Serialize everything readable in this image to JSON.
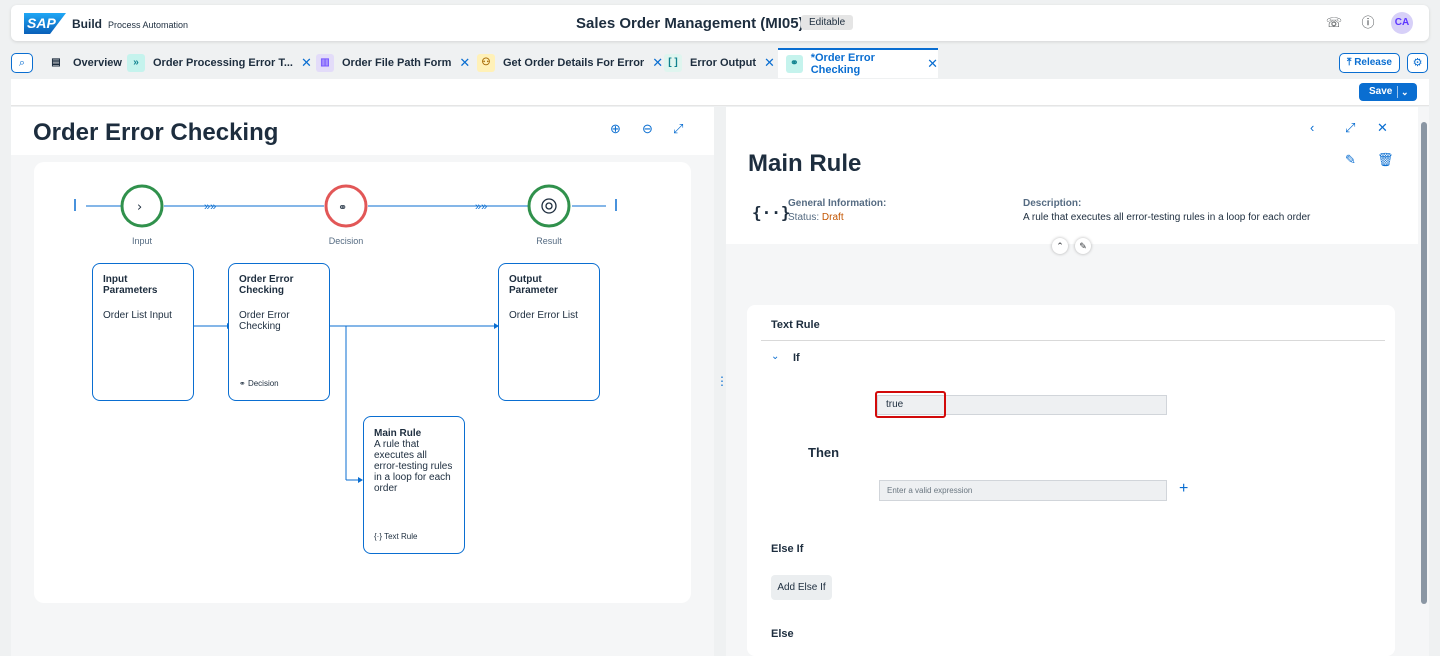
{
  "shell": {
    "logo": "SAP",
    "brand": "Build",
    "product": "Process Automation",
    "title": "Sales Order Management (MI05)",
    "badge": "Editable",
    "avatar": "CA"
  },
  "tabs": [
    {
      "label": "Overview",
      "icon": "overview-icon",
      "active": false
    },
    {
      "label": "Order Processing Error T...",
      "icon": "process-icon",
      "active": false
    },
    {
      "label": "Order File Path Form",
      "icon": "form-icon",
      "active": false
    },
    {
      "label": "Get Order Details For Error",
      "icon": "automation-icon",
      "active": false
    },
    {
      "label": "Error Output",
      "icon": "datatype-icon",
      "active": false
    },
    {
      "label": "*Order Error Checking",
      "icon": "decision-icon",
      "active": true
    }
  ],
  "toolbar": {
    "release_label": "Release",
    "save_label": "Save"
  },
  "left": {
    "title": "Order Error Checking",
    "steps": {
      "input": "Input",
      "decision": "Decision",
      "result": "Result"
    },
    "nodes": {
      "input_params": {
        "title": "Input Parameters",
        "body": "Order List Input"
      },
      "order_check": {
        "title": "Order Error Checking",
        "body": "Order Error Checking",
        "footer": "Decision"
      },
      "output_param": {
        "title": "Output Parameter",
        "body": "Order Error List"
      },
      "main_rule": {
        "title": "Main Rule",
        "body": "A rule that executes all error-testing rules in a loop for each order",
        "footer": "Text Rule"
      }
    }
  },
  "right": {
    "title": "Main Rule",
    "general_label": "General Information:",
    "status_label": "Status:",
    "status_value": "Draft",
    "description_label": "Description:",
    "description": "A rule that executes all error-testing rules in a loop for each order",
    "rule": {
      "heading": "Text Rule",
      "if_label": "If",
      "condition": "true",
      "then_label": "Then",
      "expression_placeholder": "Enter a valid expression",
      "else_if_label": "Else If",
      "add_else_if": "Add Else If",
      "else_label": "Else"
    }
  },
  "colors": {
    "accent": "#0a6ed1",
    "input_green": "#30914c",
    "decision_red": "#e25757",
    "highlight": "#d20a0a"
  }
}
